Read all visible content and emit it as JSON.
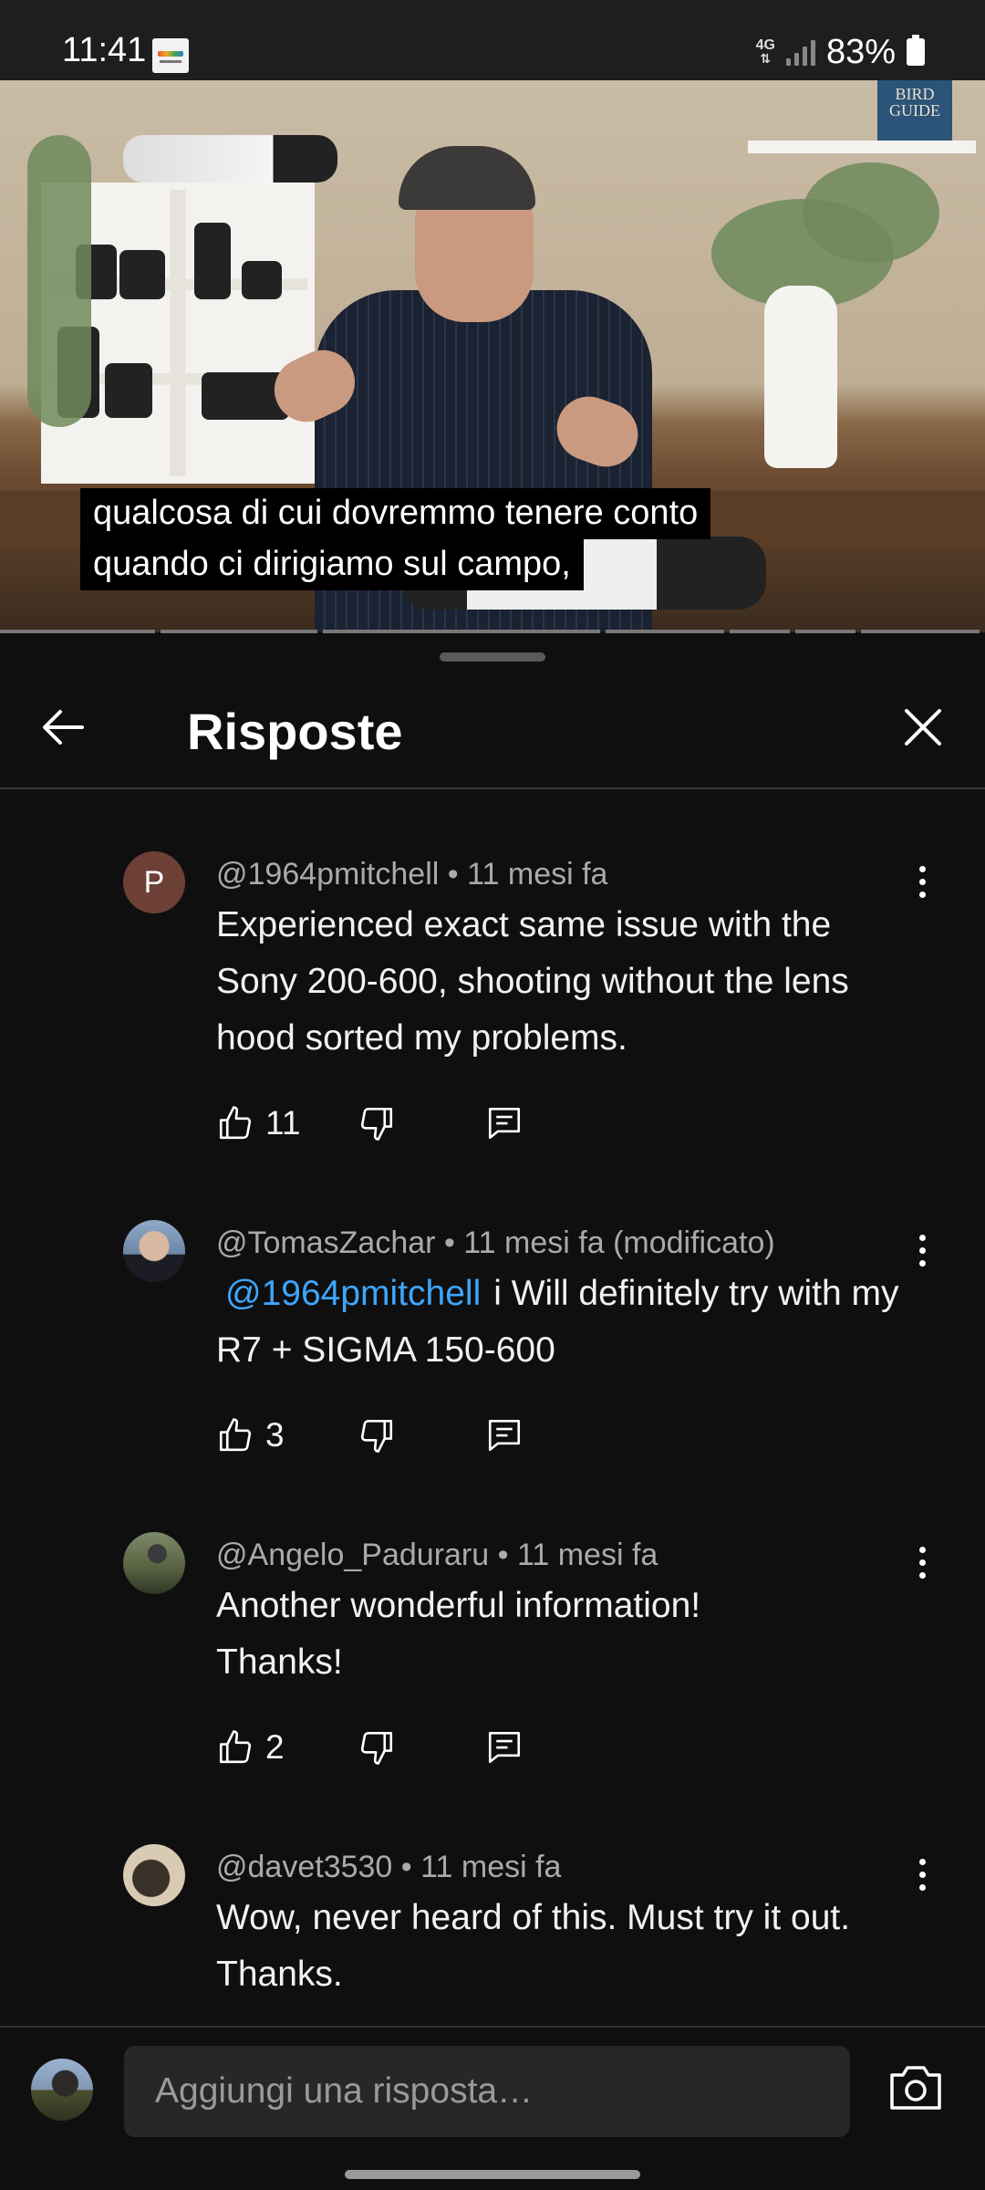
{
  "status_bar": {
    "time": "11:41",
    "network_label": "4G",
    "battery_percent": "83%",
    "icons": [
      "app-notification-icon",
      "network-4g-icon",
      "signal-icon",
      "battery-icon"
    ]
  },
  "video": {
    "caption_lines": [
      "qualcosa di cui dovremmo tenere conto",
      "quando ci dirigiamo sul campo,"
    ],
    "background_book_text": "BIRD GUIDE"
  },
  "replies_panel": {
    "title": "Risposte",
    "back_icon": "arrow-left-icon",
    "close_icon": "close-icon"
  },
  "comments": [
    {
      "avatar_letter": "P",
      "author": "@1964pmitchell",
      "separator": "•",
      "time": "11 mesi fa",
      "edited": "",
      "mention": "",
      "text": "Experienced exact same issue with the Sony 200-600, shooting without the lens hood sorted my problems.",
      "likes": "11"
    },
    {
      "avatar_letter": "",
      "author": "@TomasZachar",
      "separator": "•",
      "time": "11 mesi fa",
      "edited": "(modificato)",
      "mention": "@1964pmitchell",
      "text": "i Will definitely try with my R7 + SIGMA 150-600",
      "likes": "3"
    },
    {
      "avatar_letter": "",
      "author": "@Angelo_Paduraru",
      "separator": "•",
      "time": "11 mesi fa",
      "edited": "",
      "mention": "",
      "text": "Another wonderful information! Thanks!",
      "likes": "2"
    },
    {
      "avatar_letter": "",
      "author": "@davet3530",
      "separator": "•",
      "time": "11 mesi fa",
      "edited": "",
      "mention": "",
      "text": "Wow, never heard of this. Must try it out. Thanks.",
      "likes": ""
    }
  ],
  "composer": {
    "placeholder": "Aggiungi una risposta…",
    "value": "",
    "camera_icon": "camera-icon"
  },
  "colors": {
    "background": "#0f0f0f",
    "mention": "#3ea6ff",
    "meta_text": "#aaaaaa",
    "input_background": "#272727"
  }
}
